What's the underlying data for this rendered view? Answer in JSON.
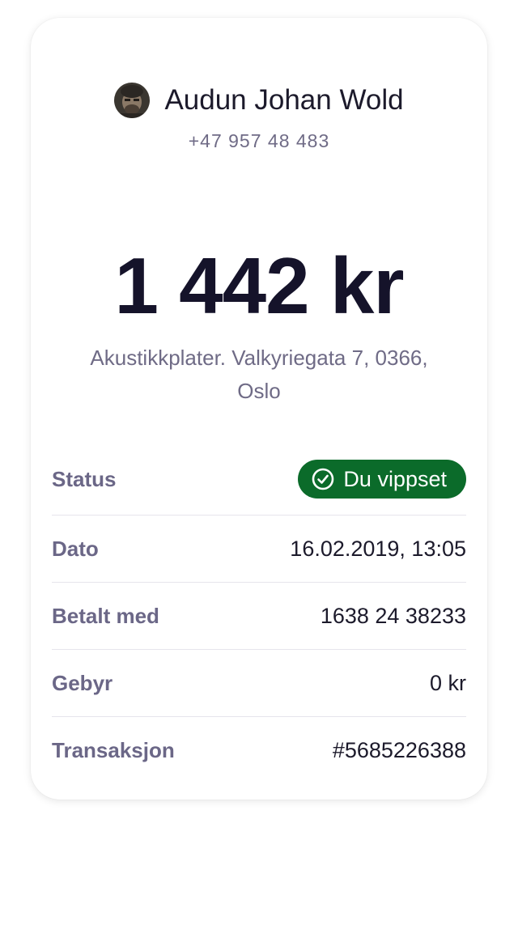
{
  "recipient": {
    "name": "Audun Johan Wold",
    "phone": "+47 957 48 483"
  },
  "amount": "1 442 kr",
  "message": "Akustikkplater. Valkyriegata 7, 0366, Oslo",
  "details": {
    "status": {
      "label": "Status",
      "value": "Du vippset",
      "icon": "check-circle-icon",
      "color": "#0b6b2a"
    },
    "date": {
      "label": "Dato",
      "value": "16.02.2019, 13:05"
    },
    "paid_with": {
      "label": "Betalt med",
      "value": "1638 24 38233"
    },
    "fee": {
      "label": "Gebyr",
      "value": "0 kr"
    },
    "transaction": {
      "label": "Transaksjon",
      "value": "#5685226388"
    }
  }
}
